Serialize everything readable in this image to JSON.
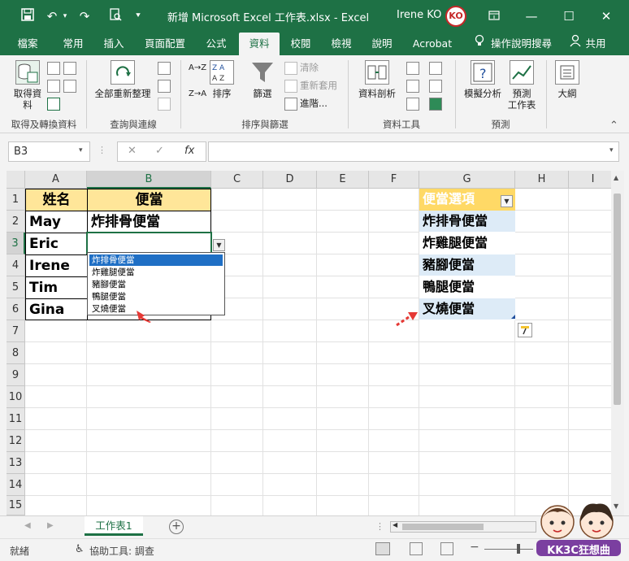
{
  "window": {
    "title": "新增 Microsoft Excel 工作表.xlsx  -  Excel",
    "user": "Irene KO",
    "avatar_text": "KO"
  },
  "tabs": [
    "檔案",
    "常用",
    "插入",
    "頁面配置",
    "公式",
    "資料",
    "校閱",
    "檢視",
    "說明",
    "Acrobat",
    "操作說明搜尋",
    "共用"
  ],
  "active_tab": "資料",
  "ribbon": {
    "get_data": "取得資\n料",
    "refresh_all": "全部重新整理",
    "sort_asc": "A→Z",
    "sort_desc": "Z→A",
    "sort": "排序",
    "filter": "篩選",
    "clear": "清除",
    "reapply": "重新套用",
    "advanced": "進階...",
    "text_to_columns": "資料剖析",
    "what_if": "模擬分析",
    "forecast_sheet": "預測\n工作表",
    "outline": "大綱",
    "groups": {
      "get_transform": "取得及轉換資料",
      "queries": "查詢與連線",
      "sort_filter": "排序與篩選",
      "data_tools": "資料工具",
      "forecast": "預測"
    }
  },
  "formula_bar": {
    "name_box": "B3",
    "fx": "fx",
    "cancel": "✕",
    "enter": "✓",
    "value": ""
  },
  "columns": [
    "A",
    "B",
    "C",
    "D",
    "E",
    "F",
    "G",
    "H",
    "I"
  ],
  "rows": [
    "1",
    "2",
    "3",
    "4",
    "5",
    "6",
    "7",
    "8",
    "9",
    "10",
    "11",
    "12",
    "13",
    "14",
    "15"
  ],
  "cells": {
    "A1": "姓名",
    "B1": "便當",
    "A2": "May",
    "B2": "炸排骨便當",
    "A3": "Eric",
    "A4": "Irene",
    "A5": "Tim",
    "A6": "Gina",
    "G1": "便當選項",
    "G2": "炸排骨便當",
    "G3": "炸雞腿便當",
    "G4": "豬腳便當",
    "G5": "鴨腿便當",
    "G6": "叉燒便當"
  },
  "dropdown": {
    "items": [
      "炸排骨便當",
      "炸雞腿便當",
      "豬腳便當",
      "鴨腿便當",
      "叉燒便當"
    ],
    "highlighted_index": 0
  },
  "sheet_tab": "工作表1",
  "status": {
    "ready": "就緒",
    "accessibility": "協助工具: 調查"
  },
  "watermark": "KK3C狂想曲",
  "colors": {
    "brand": "#1e7145",
    "header_fill": "#ffe699",
    "list_header": "#ffd966",
    "list_band": "#ddebf7",
    "arrow": "#e53935"
  }
}
